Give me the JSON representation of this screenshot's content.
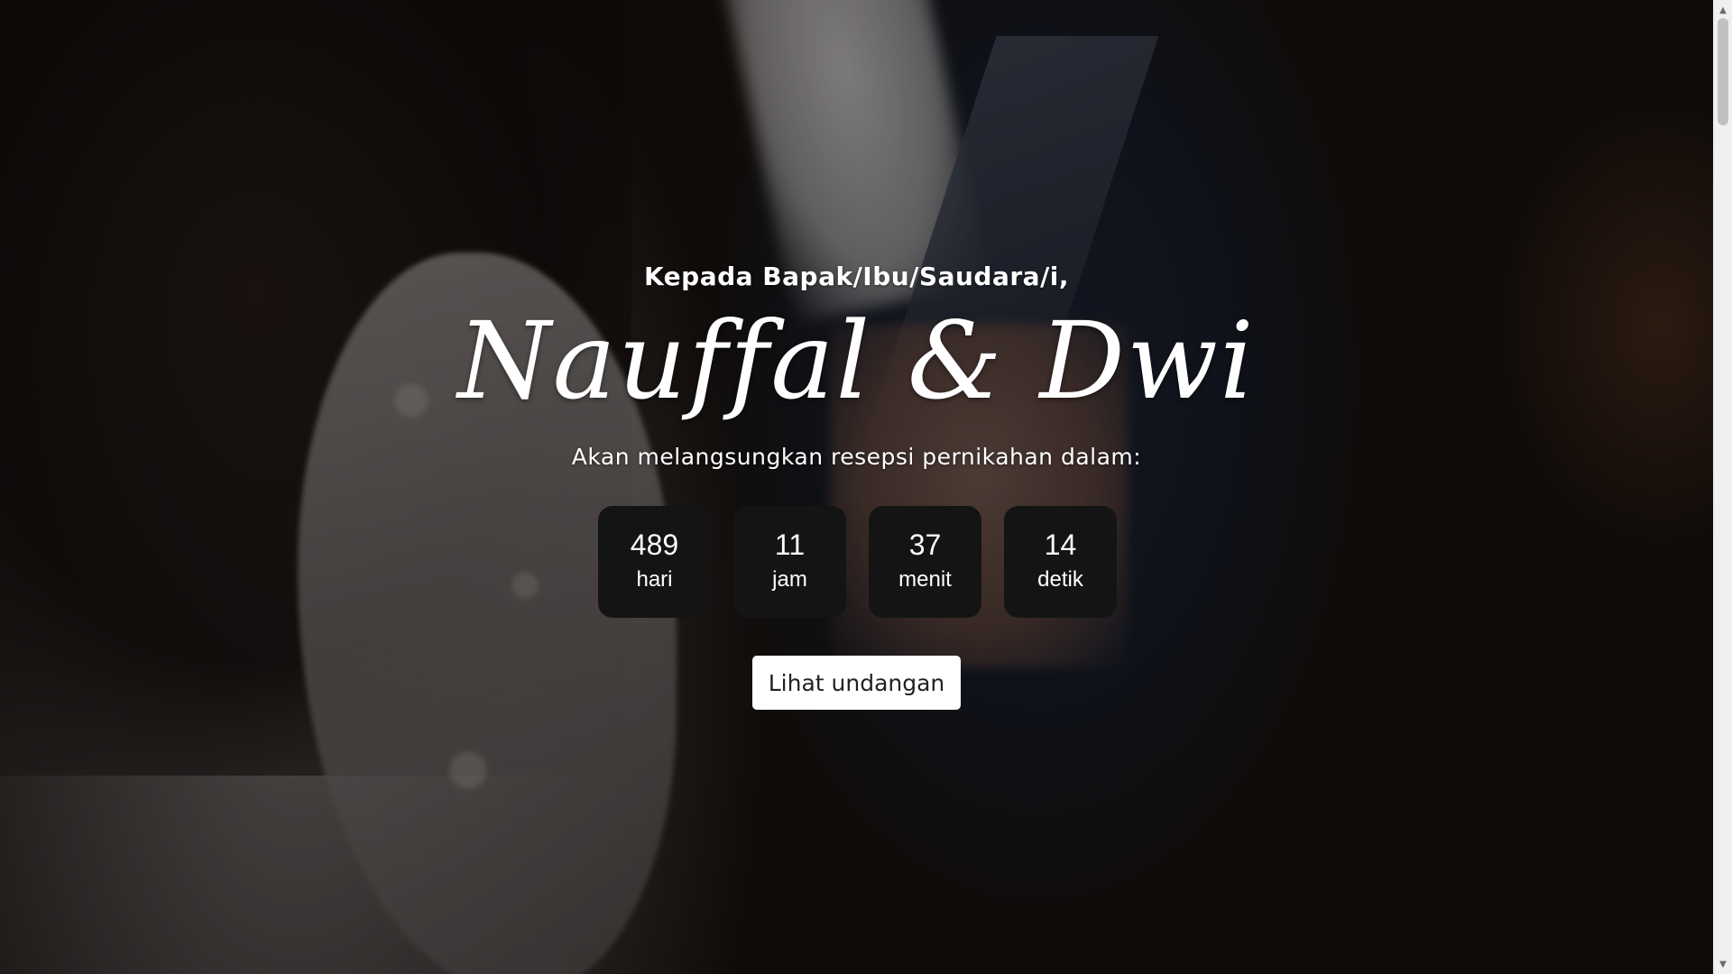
{
  "hero": {
    "greeting": "Kepada Bapak/Ibu/Saudara/i,",
    "couple_names": "Nauffal & Dwi",
    "subtitle": "Akan melangsungkan resepsi pernikahan dalam:",
    "countdown": [
      {
        "value": "489",
        "unit": "hari"
      },
      {
        "value": "11",
        "unit": "jam"
      },
      {
        "value": "37",
        "unit": "menit"
      },
      {
        "value": "14",
        "unit": "detik"
      }
    ],
    "cta_label": "Lihat undangan"
  },
  "scrollbar": {
    "up_arrow_icon": "triangle-up-icon",
    "down_arrow_icon": "triangle-down-icon"
  },
  "colors": {
    "countdown_box": "#141414",
    "button_bg": "#ffffff",
    "text": "#ffffff"
  }
}
